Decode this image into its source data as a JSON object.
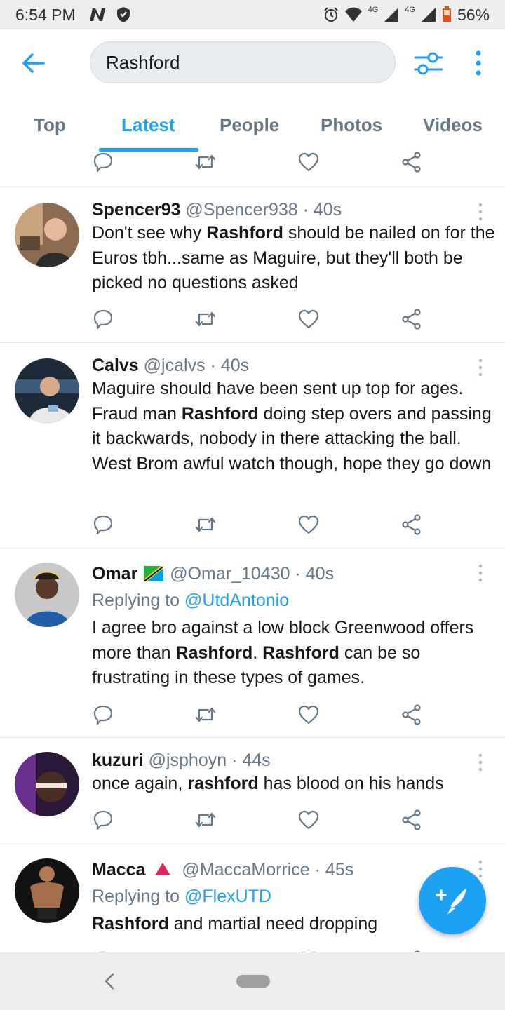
{
  "status_bar": {
    "time": "6:54 PM",
    "network_1": "4G",
    "network_2": "4G",
    "battery": "56%"
  },
  "header": {
    "search_value": "Rashford"
  },
  "tabs": [
    {
      "label": "Top",
      "active": false
    },
    {
      "label": "Latest",
      "active": true
    },
    {
      "label": "People",
      "active": false
    },
    {
      "label": "Photos",
      "active": false
    },
    {
      "label": "Videos",
      "active": false
    }
  ],
  "tweets": [
    {
      "name": "Spencer93",
      "handle": "@Spencer938",
      "time": "· 40s",
      "reply_to": "",
      "text_parts": [
        "Don't see why ",
        "Rashford",
        " should be nailed on for the Euros tbh...same as Maguire, but they'll both be picked no questions asked"
      ]
    },
    {
      "name": "Calvs",
      "handle": "@jcalvs",
      "time": "· 40s",
      "reply_to": "",
      "text_parts": [
        "Maguire should have been sent up top for ages. Fraud man ",
        "Rashford",
        " doing step overs and passing it backwards, nobody in there attacking the ball. West Brom awful watch though, hope they go down"
      ]
    },
    {
      "name": "Omar",
      "handle": "@Omar_10430",
      "time": "· 40s",
      "reply_prefix": "Replying to ",
      "reply_to": "@UtdAntonio",
      "text_parts": [
        "I agree bro against a low block Greenwood offers more than ",
        "Rashford",
        ". ",
        "Rashford",
        " can be so frustrating in these types of games."
      ]
    },
    {
      "name": "kuzuri",
      "handle": "@jsphoyn",
      "time": "· 44s",
      "reply_to": "",
      "text_parts": [
        "once again, ",
        "rashford",
        " has blood on his hands"
      ]
    },
    {
      "name": "Macca",
      "handle": "@MaccaMorrice",
      "time": "· 45s",
      "reply_prefix": "Replying to ",
      "reply_to": "@FlexUTD",
      "text_parts": [
        "Rashford",
        " and martial need dropping"
      ]
    }
  ],
  "icons": {
    "reply": "reply-icon",
    "retweet": "retweet-icon",
    "like": "heart-icon",
    "share": "share-icon",
    "compose": "compose-tweet-icon"
  },
  "colors": {
    "accent": "#1da1f2",
    "muted": "#657786",
    "text": "#14171a",
    "flag_triangle": "#e0245e"
  }
}
